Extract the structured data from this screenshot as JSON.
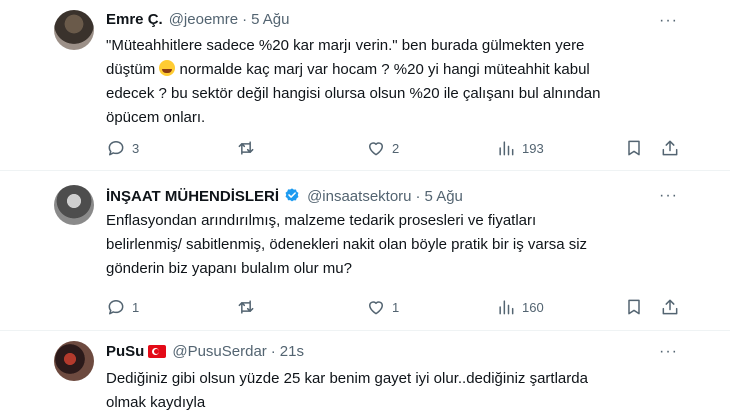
{
  "tweets": [
    {
      "name": "Emre Ç.",
      "handle": "@jeoemre",
      "separator": "·",
      "time": "5 Ağu",
      "lines": [
        "\"Müteahhitlere sadece %20 kar marjı verin.\" ben burada gülmekten yere",
        "düştüm",
        " normalde kaç marj var hocam ? %20 yi hangi müteahhit kabul",
        "edecek ?  bu sektör değil hangisi olursa olsun %20 ile çalışanı bul alnından",
        "öpücem onları."
      ],
      "emoji": "laughing-with-tears",
      "replies": "3",
      "retweets": "",
      "likes": "2",
      "views": "193"
    },
    {
      "name": "İNŞAAT MÜHENDİSLERİ",
      "handle": "@insaatsektoru",
      "separator": "·",
      "time": "5 Ağu",
      "verified": true,
      "lines": [
        "Enflasyondan arındırılmış, malzeme tedarik prosesleri ve fiyatları",
        "belirlenmiş/ sabitlenmiş, ödenekleri nakit olan böyle pratik bir iş varsa siz",
        "gönderin biz yapanı bulalım olur mu?"
      ],
      "replies": "1",
      "retweets": "",
      "likes": "1",
      "views": "160"
    },
    {
      "name": "PuSu",
      "handle": "@PusuSerdar",
      "separator": "·",
      "time": "21s",
      "flag": "turkey-flag",
      "lines": [
        "Dediğiniz gibi olsun yüzde 25 kar benim gayet iyi olur..dediğiniz şartlarda",
        "olmak kaydıyla"
      ]
    }
  ],
  "more_label": "···",
  "colors": {
    "text": "#0f1419",
    "muted": "#536471",
    "verified": "#1d9bf0",
    "divider": "#eff3f4"
  }
}
